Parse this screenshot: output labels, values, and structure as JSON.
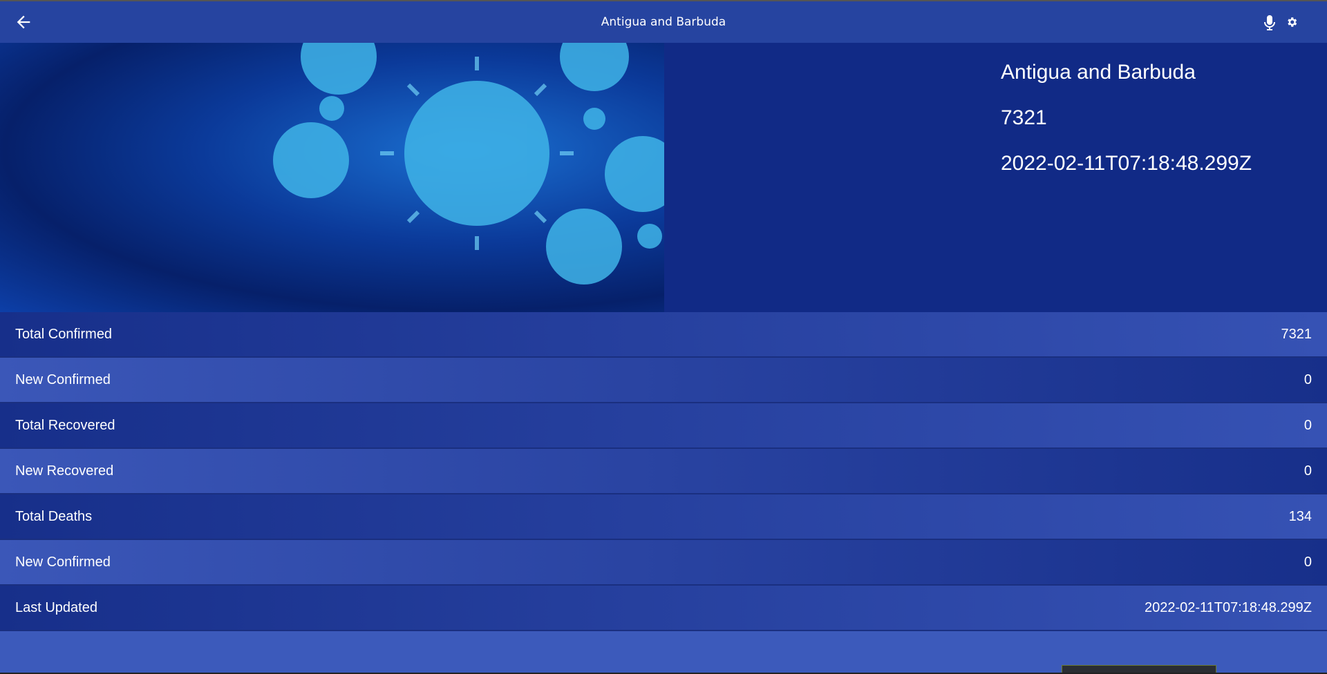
{
  "header": {
    "title": "Antigua and Barbuda",
    "back_icon": "arrow-left-icon",
    "mic_icon": "microphone-icon",
    "settings_icon": "gear-icon"
  },
  "hero": {
    "country": "Antigua and Barbuda",
    "total": "7321",
    "date": "2022-02-11T07:18:48.299Z"
  },
  "stats": [
    {
      "label": "Total Confirmed",
      "value": "7321"
    },
    {
      "label": "New Confirmed",
      "value": "0"
    },
    {
      "label": "Total Recovered",
      "value": "0"
    },
    {
      "label": "New Recovered",
      "value": "0"
    },
    {
      "label": "Total Deaths",
      "value": "134"
    },
    {
      "label": "New Confirmed",
      "value": "0"
    },
    {
      "label": "Last Updated",
      "value": "2022-02-11T07:18:48.299Z"
    }
  ],
  "colors": {
    "header": "#2644a0",
    "hero_bg": "#112a86",
    "page_bg": "#3c5abb"
  }
}
